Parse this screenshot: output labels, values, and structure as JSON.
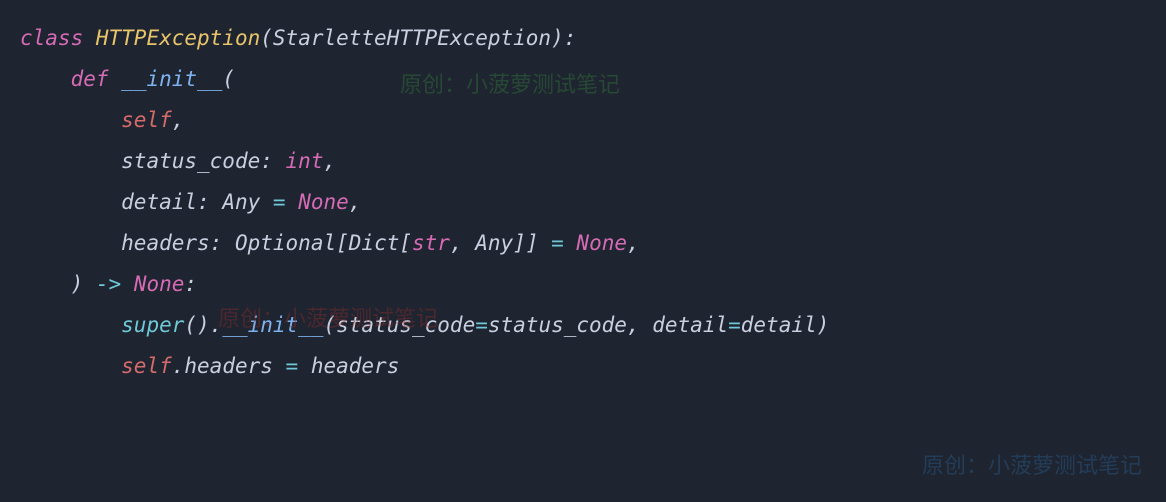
{
  "code": {
    "line1": {
      "kw_class": "class",
      "classname": "HTTPException",
      "lparen": "(",
      "base": "StarletteHTTPException",
      "rparen_colon": "):"
    },
    "line2": {
      "kw_def": "def",
      "fn": "__init__",
      "lparen": "("
    },
    "line3": {
      "self": "self",
      "comma": ","
    },
    "line4": {
      "param": "status_code",
      "colon": ": ",
      "type": "int",
      "comma": ","
    },
    "line5": {
      "param": "detail",
      "colon": ": ",
      "type": "Any",
      "eq": " = ",
      "val": "None",
      "comma": ","
    },
    "line6": {
      "param": "headers",
      "colon": ": ",
      "opt": "Optional",
      "lb": "[",
      "dict": "Dict",
      "lb2": "[",
      "str": "str",
      "c1": ", ",
      "any": "Any",
      "rb": "]]",
      "eq": " = ",
      "val": "None",
      "comma": ","
    },
    "line7": {
      "rparen": ")",
      "arrow": " -> ",
      "none": "None",
      "colon": ":"
    },
    "line8": {
      "super": "super",
      "parens": "()",
      "dot": ".",
      "dunder": "__init__",
      "lparen": "(",
      "p1": "status_code",
      "eq1": "=",
      "v1": "status_code",
      "c": ", ",
      "p2": "detail",
      "eq2": "=",
      "v2": "detail",
      "rparen": ")"
    },
    "line9": {
      "self": "self",
      "dot": ".",
      "attr": "headers",
      "eq": " = ",
      "val": "headers"
    }
  },
  "watermarks": {
    "w1": "原创：小菠萝测试笔记",
    "w2": "原创：小菠萝测试笔记",
    "w3": "原创：小菠萝测试笔记"
  }
}
